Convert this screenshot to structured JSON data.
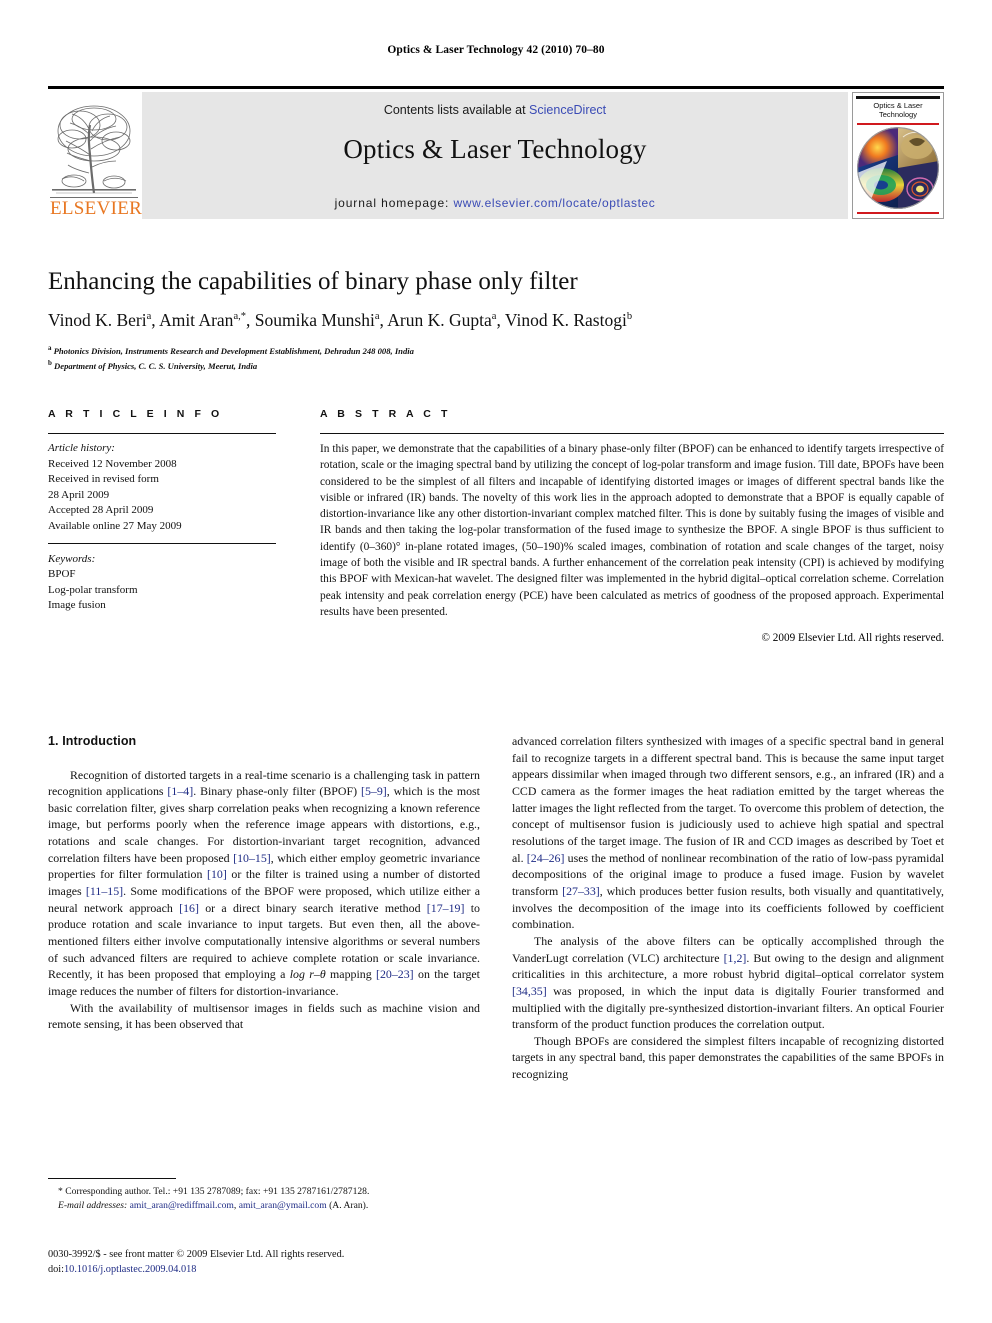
{
  "running_head": "Optics & Laser Technology 42 (2010) 70–80",
  "masthead": {
    "publisher_logo_text": "ELSEVIER",
    "contents_prefix": "Contents lists available at ",
    "contents_link": "ScienceDirect",
    "journal_title": "Optics & Laser Technology",
    "homepage_prefix": "journal homepage: ",
    "homepage_url": "www.elsevier.com/locate/optlastec",
    "cover_title_line1": "Optics & Laser",
    "cover_title_line2": "Technology"
  },
  "article": {
    "title": "Enhancing the capabilities of binary phase only filter",
    "authors": [
      {
        "name": "Vinod K. Beri",
        "sup": "a"
      },
      {
        "name": "Amit Aran",
        "sup": "a,*"
      },
      {
        "name": "Soumika Munshi",
        "sup": "a"
      },
      {
        "name": "Arun K. Gupta",
        "sup": "a"
      },
      {
        "name": "Vinod K. Rastogi",
        "sup": "b"
      }
    ],
    "affiliations": [
      {
        "sup": "a",
        "text": "Photonics Division, Instruments Research and Development Establishment, Dehradun 248 008, India"
      },
      {
        "sup": "b",
        "text": "Department of Physics, C. C. S. University, Meerut, India"
      }
    ]
  },
  "article_info": {
    "heading": "A R T I C L E   I N F O",
    "history_label": "Article history:",
    "history": [
      "Received 12 November 2008",
      "Received in revised form",
      "28 April 2009",
      "Accepted 28 April 2009",
      "Available online 27 May 2009"
    ],
    "keywords_label": "Keywords:",
    "keywords": [
      "BPOF",
      "Log-polar transform",
      "Image fusion"
    ]
  },
  "abstract": {
    "heading": "A B S T R A C T",
    "text": "In this paper, we demonstrate that the capabilities of a binary phase-only filter (BPOF) can be enhanced to identify targets irrespective of rotation, scale or the imaging spectral band by utilizing the concept of log-polar transform and image fusion. Till date, BPOFs have been considered to be the simplest of all filters and incapable of identifying distorted images or images of different spectral bands like the visible or infrared (IR) bands. The novelty of this work lies in the approach adopted to demonstrate that a BPOF is equally capable of distortion-invariance like any other distortion-invariant complex matched filter. This is done by suitably fusing the images of visible and IR bands and then taking the log-polar transformation of the fused image to synthesize the BPOF. A single BPOF is thus sufficient to identify (0–360)° in-plane rotated images, (50–190)% scaled images, combination of rotation and scale changes of the target, noisy image of both the visible and IR spectral bands. A further enhancement of the correlation peak intensity (CPI) is achieved by modifying this BPOF with Mexican-hat wavelet. The designed filter was implemented in the hybrid digital–optical correlation scheme. Correlation peak intensity and peak correlation energy (PCE) have been calculated as metrics of goodness of the proposed approach. Experimental results have been presented.",
    "copyright": "© 2009 Elsevier Ltd. All rights reserved."
  },
  "body": {
    "section_heading": "1. Introduction",
    "left_paragraphs": [
      "Recognition of distorted targets in a real-time scenario is a challenging task in pattern recognition applications [1–4]. Binary phase-only filter (BPOF) [5–9], which is the most basic correlation filter, gives sharp correlation peaks when recognizing a known reference image, but performs poorly when the reference image appears with distortions, e.g., rotations and scale changes. For distortion-invariant target recognition, advanced correlation filters have been proposed [10–15], which either employ geometric invariance properties for filter formulation [10] or the filter is trained using a number of distorted images [11–15]. Some modifications of the BPOF were proposed, which utilize either a neural network approach [16] or a direct binary search iterative method [17–19] to produce rotation and scale invariance to input targets. But even then, all the above-mentioned filters either involve computationally intensive algorithms or several numbers of such advanced filters are required to achieve complete rotation or scale invariance. Recently, it has been proposed that employing a log r–θ mapping [20–23] on the target image reduces the number of filters for distortion-invariance.",
      "With the availability of multisensor images in fields such as machine vision and remote sensing, it has been observed that"
    ],
    "right_paragraphs": [
      "advanced correlation filters synthesized with images of a specific spectral band in general fail to recognize targets in a different spectral band. This is because the same input target appears dissimilar when imaged through two different sensors, e.g., an infrared (IR) and a CCD camera as the former images the heat radiation emitted by the target whereas the latter images the light reflected from the target. To overcome this problem of detection, the concept of multisensor fusion is judiciously used to achieve high spatial and spectral resolutions of the target image. The fusion of IR and CCD images as described by Toet et al. [24–26] uses the method of nonlinear recombination of the ratio of low-pass pyramidal decompositions of the original image to produce a fused image. Fusion by wavelet transform [27–33], which produces better fusion results, both visually and quantitatively, involves the decomposition of the image into its coefficients followed by coefficient combination.",
      "The analysis of the above filters can be optically accomplished through the VanderLugt correlation (VLC) architecture [1,2]. But owing to the design and alignment criticalities in this architecture, a more robust hybrid digital–optical correlator system [34,35] was proposed, in which the input data is digitally Fourier transformed and multiplied with the digitally pre-synthesized distortion-invariant filters. An optical Fourier transform of the product function produces the correlation output.",
      "Though BPOFs are considered the simplest filters incapable of recognizing distorted targets in any spectral band, this paper demonstrates the capabilities of the same BPOFs in recognizing"
    ]
  },
  "footnotes": {
    "corresponding": "* Corresponding author. Tel.: +91 135 2787089; fax: +91 135 2787161/2787128.",
    "email_label": "E-mail addresses:",
    "email1": "amit_aran@rediffmail.com",
    "email2": "amit_aran@ymail.com",
    "email_suffix": "(A. Aran)."
  },
  "imprint": {
    "issn_line": "0030-3992/$ - see front matter © 2009 Elsevier Ltd. All rights reserved.",
    "doi_label": "doi:",
    "doi_value": "10.1016/j.optlastec.2009.04.018"
  },
  "colors": {
    "link_blue": "#1f2c85",
    "sciencedirect_blue": "#3a4bb5",
    "elsevier_orange": "#E87722",
    "cover_red": "#d0191e",
    "band_grey": "#e6e6e6"
  }
}
